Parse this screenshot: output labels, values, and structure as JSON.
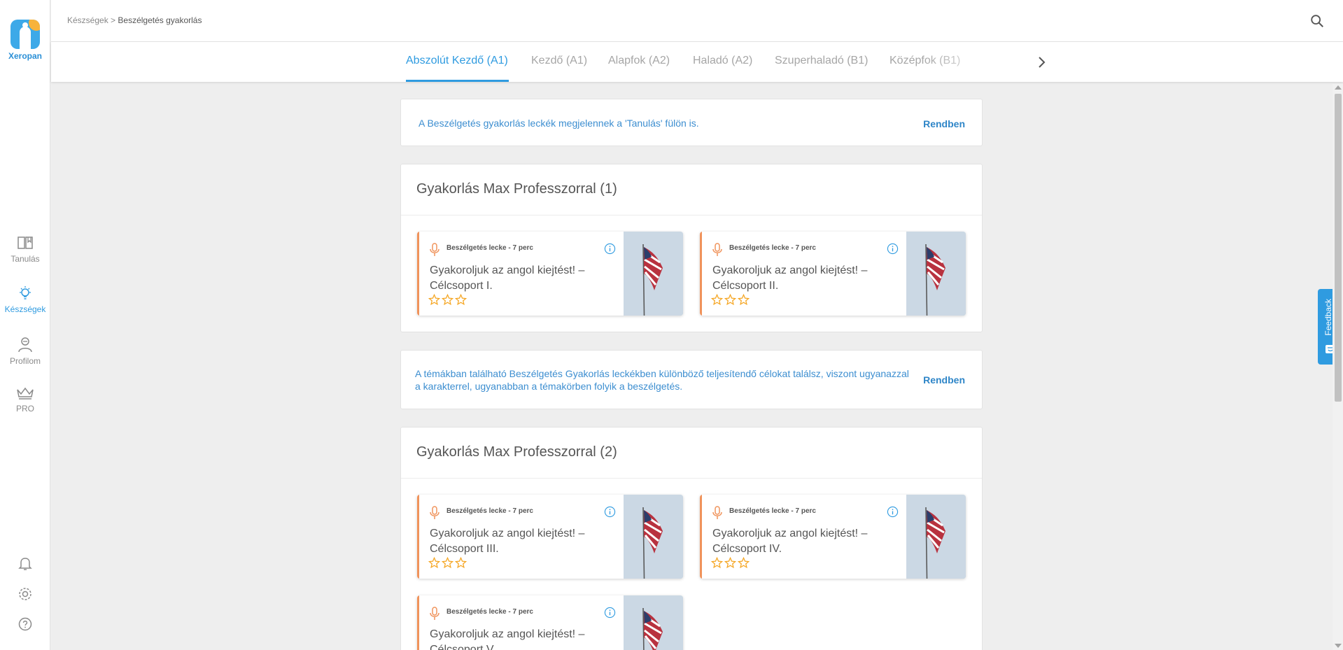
{
  "app": {
    "logo_text": "Xeropan"
  },
  "sidebar": {
    "items": [
      {
        "label": "Tanulás",
        "icon": "book-icon",
        "active": false
      },
      {
        "label": "Készségek",
        "icon": "lightbulb-icon",
        "active": true
      },
      {
        "label": "Profilom",
        "icon": "user-icon",
        "active": false
      },
      {
        "label": "PRO",
        "icon": "crown-icon",
        "active": false
      }
    ],
    "bottom_icons": [
      "bell-icon",
      "gear-icon",
      "help-icon"
    ]
  },
  "breadcrumb": {
    "parent": "Készségek",
    "separator": " > ",
    "current": "Beszélgetés gyakorlás"
  },
  "tabs": [
    {
      "label": "Abszolút Kezdő (A1)",
      "active": true
    },
    {
      "label": "Kezdő (A1)",
      "active": false
    },
    {
      "label": "Alapfok (A2)",
      "active": false
    },
    {
      "label": "Haladó (A2)",
      "active": false
    },
    {
      "label": "Szuperhaladó (B1)",
      "active": false
    },
    {
      "label": "Középfok (B1)",
      "active": false
    }
  ],
  "notices": [
    {
      "text": "A Beszélgetés gyakorlás leckék megjelennek a 'Tanulás' fülön is.",
      "button": "Rendben"
    },
    {
      "text": "A témákban található Beszélgetés Gyakorlás leckékben különböző teljesítendő célokat találsz, viszont ugyanazzal a karakterrel, ugyanabban a témakörben folyik a beszélgetés.",
      "button": "Rendben"
    }
  ],
  "sections": [
    {
      "title": "Gyakorlás Max Professzorral (1)",
      "lessons": [
        {
          "kind": "Beszélgetés lecke - 7 perc",
          "title": "Gyakoroljuk az angol kiejtést! – Célcsoport I.",
          "stars": 0,
          "max_stars": 3
        },
        {
          "kind": "Beszélgetés lecke - 7 perc",
          "title": "Gyakoroljuk az angol kiejtést! – Célcsoport II.",
          "stars": 0,
          "max_stars": 3
        }
      ]
    },
    {
      "title": "Gyakorlás Max Professzorral (2)",
      "lessons": [
        {
          "kind": "Beszélgetés lecke - 7 perc",
          "title": "Gyakoroljuk az angol kiejtést! – Célcsoport III.",
          "stars": 0,
          "max_stars": 3
        },
        {
          "kind": "Beszélgetés lecke - 7 perc",
          "title": "Gyakoroljuk az angol kiejtést! – Célcsoport IV.",
          "stars": 0,
          "max_stars": 3
        },
        {
          "kind": "Beszélgetés lecke - 7 perc",
          "title": "Gyakoroljuk az angol kiejtést! – Célcsoport V.",
          "stars": 0,
          "max_stars": 3
        }
      ]
    }
  ],
  "feedback": {
    "label": "Feedback"
  },
  "colors": {
    "accent": "#2f9be0",
    "lesson_accent": "#f0935b",
    "star": "#f5a623"
  }
}
